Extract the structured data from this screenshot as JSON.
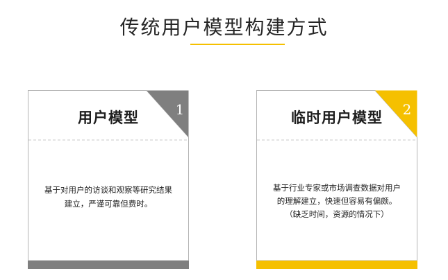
{
  "page": {
    "title": "传统用户模型构建方式",
    "accent_color": "#f5c000"
  },
  "cards": [
    {
      "number": "1",
      "title": "用户模型",
      "body_lines": [
        "基于对用户的访谈和观察等研究结果",
        "建立，严谨可靠但费时。"
      ],
      "accent_color": "#7f7f7f"
    },
    {
      "number": "2",
      "title": "临时用户模型",
      "body_lines": [
        "基于行业专家或市场调查数据对用户",
        "的理解建立，快速但容易有偏颇。",
        "（缺乏时间，资源的情况下）"
      ],
      "accent_color": "#f5c000"
    }
  ]
}
